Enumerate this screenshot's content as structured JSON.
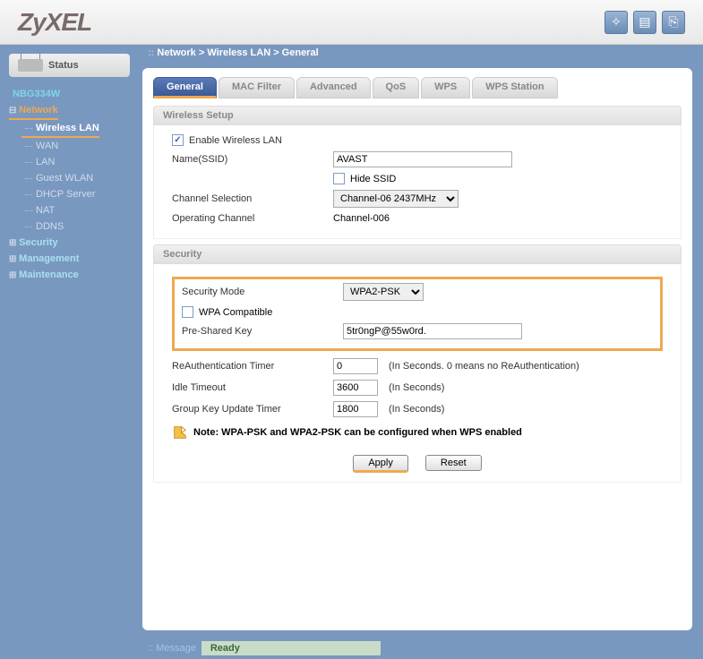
{
  "logo": "ZyXEL",
  "header_icons": [
    "wizard-icon",
    "doc-icon",
    "logout-icon"
  ],
  "breadcrumb": "Network > Wireless LAN > General",
  "sidebar": {
    "status_label": "Status",
    "device": "NBG334W",
    "sections": [
      {
        "label": "Network",
        "expanded": true,
        "active": true,
        "items": [
          "Wireless LAN",
          "WAN",
          "LAN",
          "Guest WLAN",
          "DHCP Server",
          "NAT",
          "DDNS"
        ],
        "active_item": "Wireless LAN"
      },
      {
        "label": "Security",
        "expanded": false
      },
      {
        "label": "Management",
        "expanded": false
      },
      {
        "label": "Maintenance",
        "expanded": false
      }
    ]
  },
  "tabs": [
    "General",
    "MAC Filter",
    "Advanced",
    "QoS",
    "WPS",
    "WPS Station"
  ],
  "active_tab": "General",
  "wireless_setup": {
    "title": "Wireless Setup",
    "enable_label": "Enable Wireless LAN",
    "enable_checked": true,
    "ssid_label": "Name(SSID)",
    "ssid_value": "AVAST",
    "hide_ssid_label": "Hide SSID",
    "hide_ssid_checked": false,
    "channel_sel_label": "Channel Selection",
    "channel_sel_value": "Channel-06 2437MHz",
    "op_channel_label": "Operating Channel",
    "op_channel_value": "Channel-006"
  },
  "security": {
    "title": "Security",
    "mode_label": "Security Mode",
    "mode_value": "WPA2-PSK",
    "wpa_compat_label": "WPA Compatible",
    "wpa_compat_checked": false,
    "psk_label": "Pre-Shared Key",
    "psk_value": "5tr0ngP@55w0rd.",
    "reauth_label": "ReAuthentication Timer",
    "reauth_value": "0",
    "reauth_hint": "(In Seconds. 0 means no ReAuthentication)",
    "idle_label": "Idle Timeout",
    "idle_value": "3600",
    "idle_hint": "(In Seconds)",
    "group_key_label": "Group Key Update Timer",
    "group_key_value": "1800",
    "group_key_hint": "(In Seconds)",
    "note": "Note: WPA-PSK and WPA2-PSK can be configured when WPS enabled"
  },
  "buttons": {
    "apply": "Apply",
    "reset": "Reset"
  },
  "footer": {
    "label": "Message",
    "value": "Ready"
  }
}
